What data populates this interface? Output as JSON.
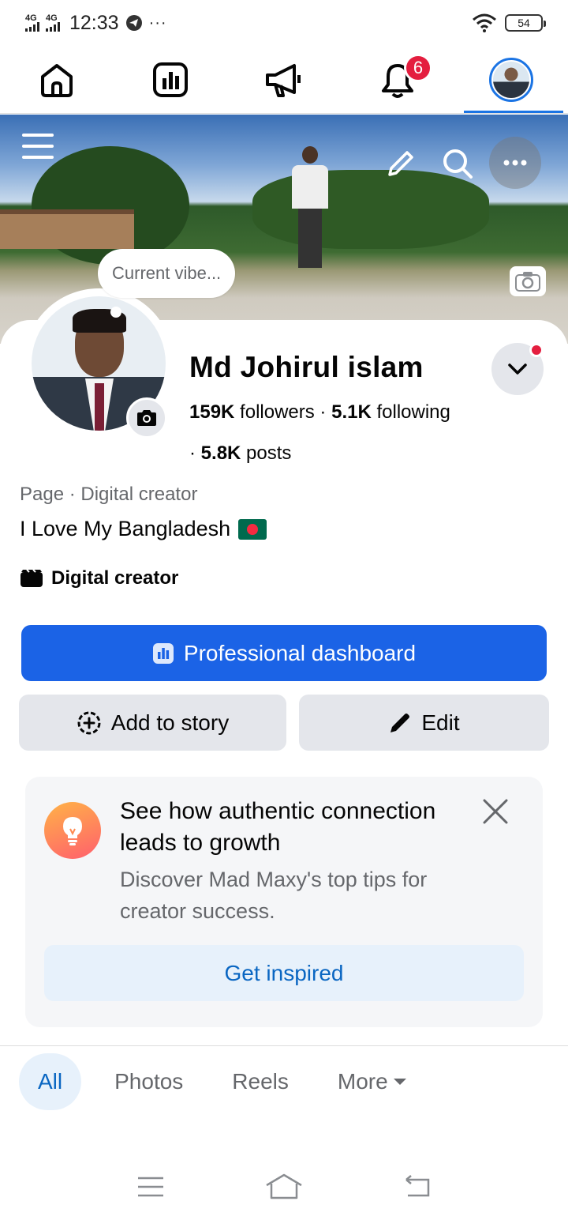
{
  "status_bar": {
    "network1": "4G",
    "network2": "4G",
    "time": "12:33",
    "overflow": "···",
    "battery": "54"
  },
  "nav": {
    "notifications_badge": "6"
  },
  "profile": {
    "vibe_placeholder": "Current vibe...",
    "name": "Md Johirul islam",
    "followers_count": "159K",
    "followers_label": "followers",
    "following_count": "5.1K",
    "following_label": "following",
    "posts_count": "5.8K",
    "posts_label": "posts",
    "category": "Page · Digital creator",
    "bio": "I Love My Bangladesh",
    "creator_label": "Digital creator"
  },
  "actions": {
    "dashboard": "Professional dashboard",
    "add_story": "Add to story",
    "edit": "Edit"
  },
  "tip": {
    "title": "See how authentic connection leads to growth",
    "subtitle": "Discover Mad Maxy's top tips for creator success.",
    "button": "Get inspired"
  },
  "tabs": {
    "all": "All",
    "photos": "Photos",
    "reels": "Reels",
    "more": "More"
  },
  "colors": {
    "accent": "#1b63e6",
    "link": "#0a66c2",
    "badge": "#e41e3f"
  }
}
